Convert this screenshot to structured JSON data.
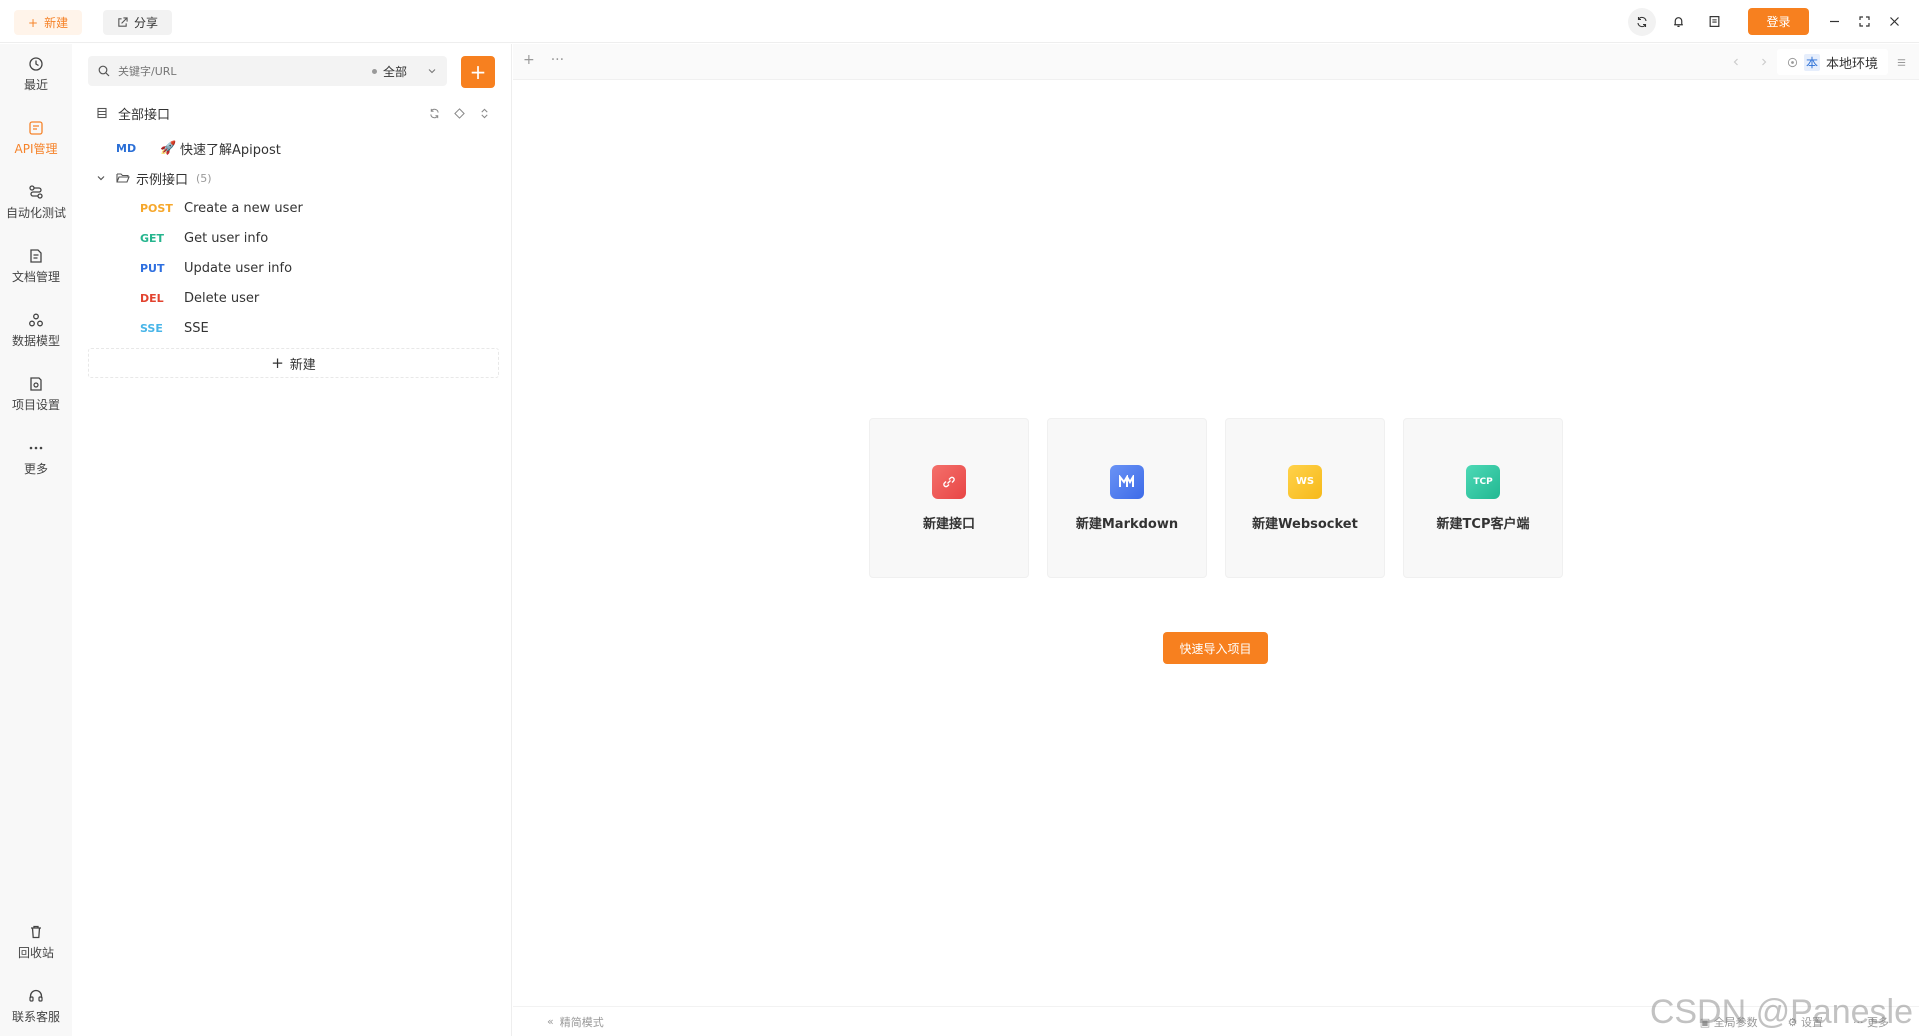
{
  "topbar": {
    "new_label": "新建",
    "share_label": "分享",
    "login_label": "登录"
  },
  "leftnav": {
    "items": [
      {
        "label": "最近",
        "icon": "history-icon"
      },
      {
        "label": "API管理",
        "icon": "api-icon",
        "active": true
      },
      {
        "label": "自动化测试",
        "icon": "automation-icon"
      },
      {
        "label": "文档管理",
        "icon": "document-icon"
      },
      {
        "label": "数据模型",
        "icon": "data-model-icon"
      },
      {
        "label": "项目设置",
        "icon": "project-settings-icon"
      },
      {
        "label": "更多",
        "icon": "more-icon"
      }
    ],
    "bottom": [
      {
        "label": "回收站",
        "icon": "trash-icon"
      },
      {
        "label": "联系客服",
        "icon": "headset-icon"
      }
    ]
  },
  "tree": {
    "search_placeholder": "关键字/URL",
    "scope": "全部",
    "header": "全部接口",
    "md_item": {
      "method": "MD",
      "name": "快速了解Apipost"
    },
    "folder": {
      "name": "示例接口",
      "count": "(5)"
    },
    "apis": [
      {
        "method": "POST",
        "name": "Create a new user"
      },
      {
        "method": "GET",
        "name": "Get user info"
      },
      {
        "method": "PUT",
        "name": "Update user info"
      },
      {
        "method": "DEL",
        "name": "Delete user"
      },
      {
        "method": "SSE",
        "name": "SSE"
      }
    ],
    "new_label": "新建"
  },
  "main": {
    "env_tag": "本",
    "env_name": "本地环境",
    "cards": [
      {
        "label": "新建接口",
        "icon": "api-link-icon",
        "color": "#ef5a55"
      },
      {
        "label": "新建Markdown",
        "icon": "markdown-icon",
        "color": "#4b7cf0"
      },
      {
        "label": "新建Websocket",
        "icon": "websocket-icon",
        "color": "#f7c22b",
        "text": "WS"
      },
      {
        "label": "新建TCP客户端",
        "icon": "tcp-icon",
        "color": "#2fc7a5",
        "text": "TCP"
      }
    ],
    "import_label": "快速导入项目"
  },
  "footer": {
    "simple_mode": "精简模式",
    "global_params": "全局参数",
    "settings": "设置",
    "more": "更多"
  },
  "watermark": "CSDN @Panesle",
  "colors": {
    "accent": "#f7801f"
  }
}
